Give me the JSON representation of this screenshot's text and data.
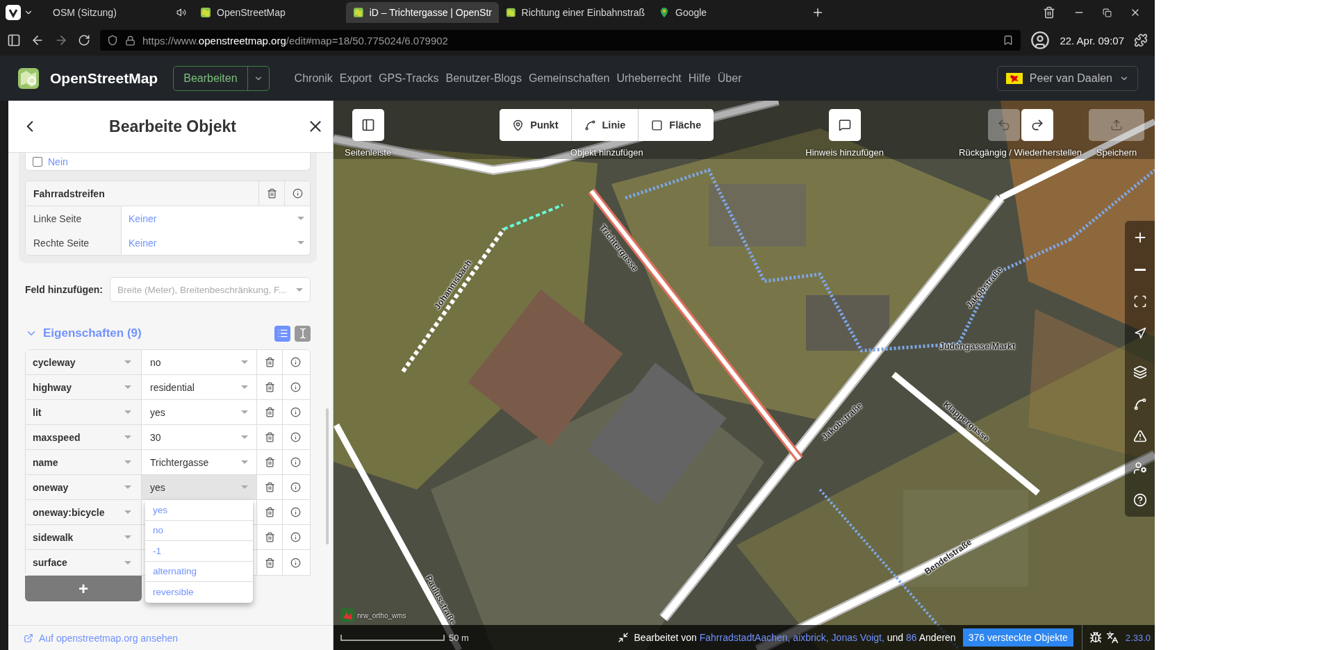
{
  "browser": {
    "tabs": [
      {
        "title": "OSM (Sitzung)",
        "selected": false
      },
      {
        "title": "OpenStreetMap",
        "selected": false
      },
      {
        "title": "iD – Trichtergasse | OpenStr",
        "selected": true
      },
      {
        "title": "Richtung einer Einbahnstraß",
        "selected": false
      },
      {
        "title": "Google",
        "selected": false
      }
    ],
    "url": "https://www.**openstreetmap.org**/edit#map=18/50.775024/6.079902",
    "clock": "22. Apr. 09:07"
  },
  "osm_header": {
    "logo": "OpenStreetMap",
    "edit_button": "Bearbeiten",
    "nav": [
      "Chronik",
      "Export",
      "GPS-Tracks",
      "Benutzer-Blogs",
      "Gemeinschaften",
      "Urheberrecht",
      "Hilfe",
      "Über"
    ],
    "user": "Peer van Daalen"
  },
  "sidebar": {
    "title": "Bearbeite Objekt",
    "check_option": {
      "label": "Nein",
      "checked": false
    },
    "lane_field": {
      "label": "Fahrradstreifen",
      "rows": [
        {
          "label": "Linke Seite",
          "value": "Keiner"
        },
        {
          "label": "Rechte Seite",
          "value": "Keiner"
        }
      ]
    },
    "add_field": {
      "label": "Feld hinzufügen:",
      "placeholder": "Breite (Meter), Breitenbeschränkung, F..."
    },
    "tags": {
      "title": "Eigenschaften (9)",
      "expanded": true,
      "views": [
        {
          "kind": "list",
          "selected": true
        },
        {
          "kind": "text",
          "selected": false
        }
      ],
      "rows": [
        {
          "key": "cycleway",
          "value": "no",
          "focused": false
        },
        {
          "key": "highway",
          "value": "residential",
          "focused": false
        },
        {
          "key": "lit",
          "value": "yes",
          "focused": false
        },
        {
          "key": "maxspeed",
          "value": "30",
          "focused": false
        },
        {
          "key": "name",
          "value": "Trichtergasse",
          "focused": false
        },
        {
          "key": "oneway",
          "value": "yes",
          "focused": true
        },
        {
          "key": "oneway:bicycle",
          "focused": false
        },
        {
          "key": "sidewalk",
          "focused": false
        },
        {
          "key": "surface",
          "focused": false
        }
      ],
      "options": [
        "yes",
        "no",
        "-1",
        "alternating",
        "reversible"
      ],
      "add_button": "+"
    },
    "view_link": "Auf openstreetmap.org ansehen"
  },
  "map": {
    "toolbar": {
      "sidebar_label": "Seitenleiste",
      "add_modes": [
        {
          "kind": "point",
          "label": "Punkt"
        },
        {
          "kind": "line",
          "label": "Linie"
        },
        {
          "kind": "area",
          "label": "Fläche"
        }
      ],
      "add_label": "Objekt hinzufügen",
      "note_label": "Hinweis hinzufügen",
      "undo_disabled": true,
      "redo_disabled": false,
      "history_label": "Rückgängig / Wiederherstellen",
      "save_label": "Speichern",
      "save_disabled": true
    },
    "street_labels": [
      "Johannisbach",
      "Trichtergasse",
      "Jakobstraße",
      "Jakobstraße",
      "Klappergasse",
      "Paulusstraße",
      "Bendelstraße",
      "Judengasse/Markt"
    ],
    "imagery": "nrw_ortho_wms",
    "footer": {
      "scale": "50 m",
      "prefix": "Bearbeitet von",
      "users": [
        "FahrradstadtAachen,",
        "aixbrick,",
        "Jonas Voigt,"
      ],
      "joiner": "und",
      "count": "86",
      "suffix": "Anderen",
      "hidden_objects": "376 versteckte Objekte",
      "version": "2.33.0"
    }
  }
}
